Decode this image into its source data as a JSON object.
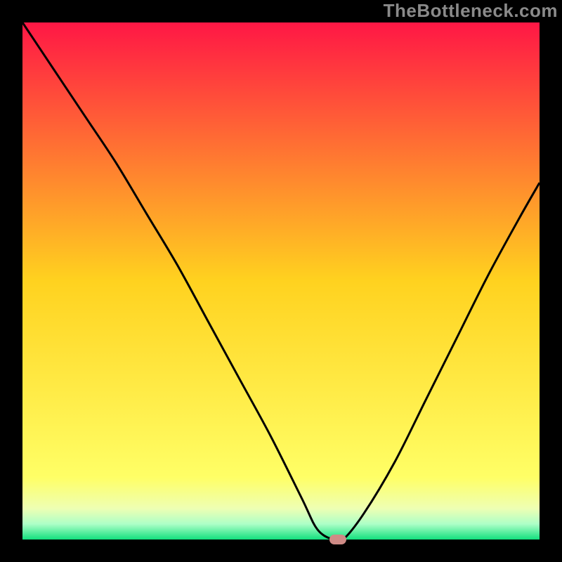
{
  "watermark": "TheBottleneck.com",
  "chart_data": {
    "type": "line",
    "title": "",
    "xlabel": "",
    "ylabel": "",
    "xlim": [
      0,
      100
    ],
    "ylim": [
      0,
      100
    ],
    "note": "Single curve over a vertical rainbow gradient. Curve values estimated from pixel positions; y=0 is the bottom (green), y=100 is the top (red).",
    "x": [
      0,
      6,
      12,
      18,
      24,
      30,
      36,
      42,
      48,
      54,
      57,
      60,
      62,
      66,
      72,
      78,
      84,
      90,
      96,
      100
    ],
    "y": [
      100,
      91,
      82,
      73,
      63,
      53,
      42,
      31,
      20,
      8,
      2,
      0,
      0,
      5,
      15,
      27,
      39,
      51,
      62,
      69
    ],
    "minimum_marker": {
      "x": 61,
      "y": 0,
      "color": "#cf8b86"
    },
    "gradient_stops": [
      {
        "pos": 0.0,
        "color": "#ff1745"
      },
      {
        "pos": 0.5,
        "color": "#ffd21f"
      },
      {
        "pos": 0.88,
        "color": "#ffff66"
      },
      {
        "pos": 0.94,
        "color": "#eeffb3"
      },
      {
        "pos": 0.97,
        "color": "#adffc7"
      },
      {
        "pos": 1.0,
        "color": "#12e07e"
      }
    ],
    "frame_color": "#000000",
    "frame_thickness_px": 32
  }
}
